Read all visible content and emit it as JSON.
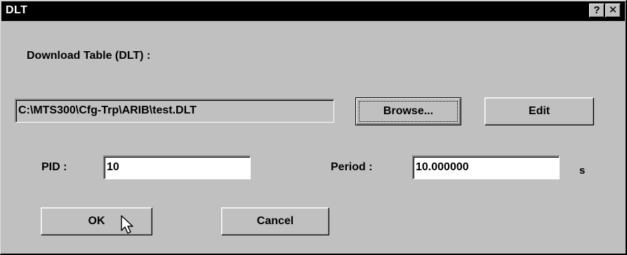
{
  "window": {
    "title": "DLT",
    "help_glyph": "?",
    "close_glyph": "✕"
  },
  "download": {
    "label": "Download Table (DLT) :",
    "path_value": "C:\\MTS300\\Cfg-Trp\\ARIB\\test.DLT",
    "browse_label": "Browse...",
    "edit_label": "Edit"
  },
  "pid": {
    "label": "PID :",
    "value": "10"
  },
  "period": {
    "label": "Period :",
    "value": "10.000000",
    "unit": "s"
  },
  "actions": {
    "ok_label": "OK",
    "cancel_label": "Cancel"
  },
  "icons": {
    "help": "help-icon",
    "close": "close-icon",
    "cursor": "mouse-pointer-icon"
  }
}
